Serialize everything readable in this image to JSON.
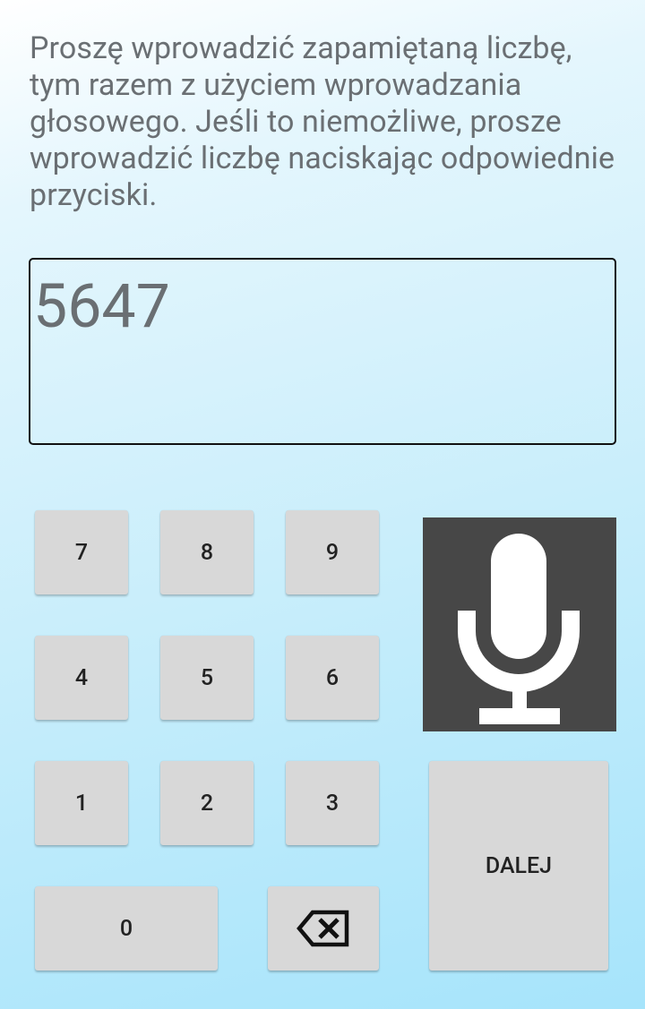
{
  "instructions": "Proszę wprowadzić zapamiętaną liczbę, tym razem z użyciem wprowadzania głosowego. Jeśli to niemożliwe, prosze wprowadzić liczbę naciskając odpowiednie przyciski.",
  "number_input": {
    "value": "5647"
  },
  "keypad": {
    "k7": "7",
    "k8": "8",
    "k9": "9",
    "k4": "4",
    "k5": "5",
    "k6": "6",
    "k1": "1",
    "k2": "2",
    "k3": "3",
    "k0": "0"
  },
  "icons": {
    "backspace": "backspace-icon",
    "microphone": "microphone-icon"
  },
  "next_button": {
    "label": "DALEJ"
  },
  "colors": {
    "text": "#6a6f73",
    "key_background": "#d8d8d8",
    "mic_background": "#474747"
  }
}
